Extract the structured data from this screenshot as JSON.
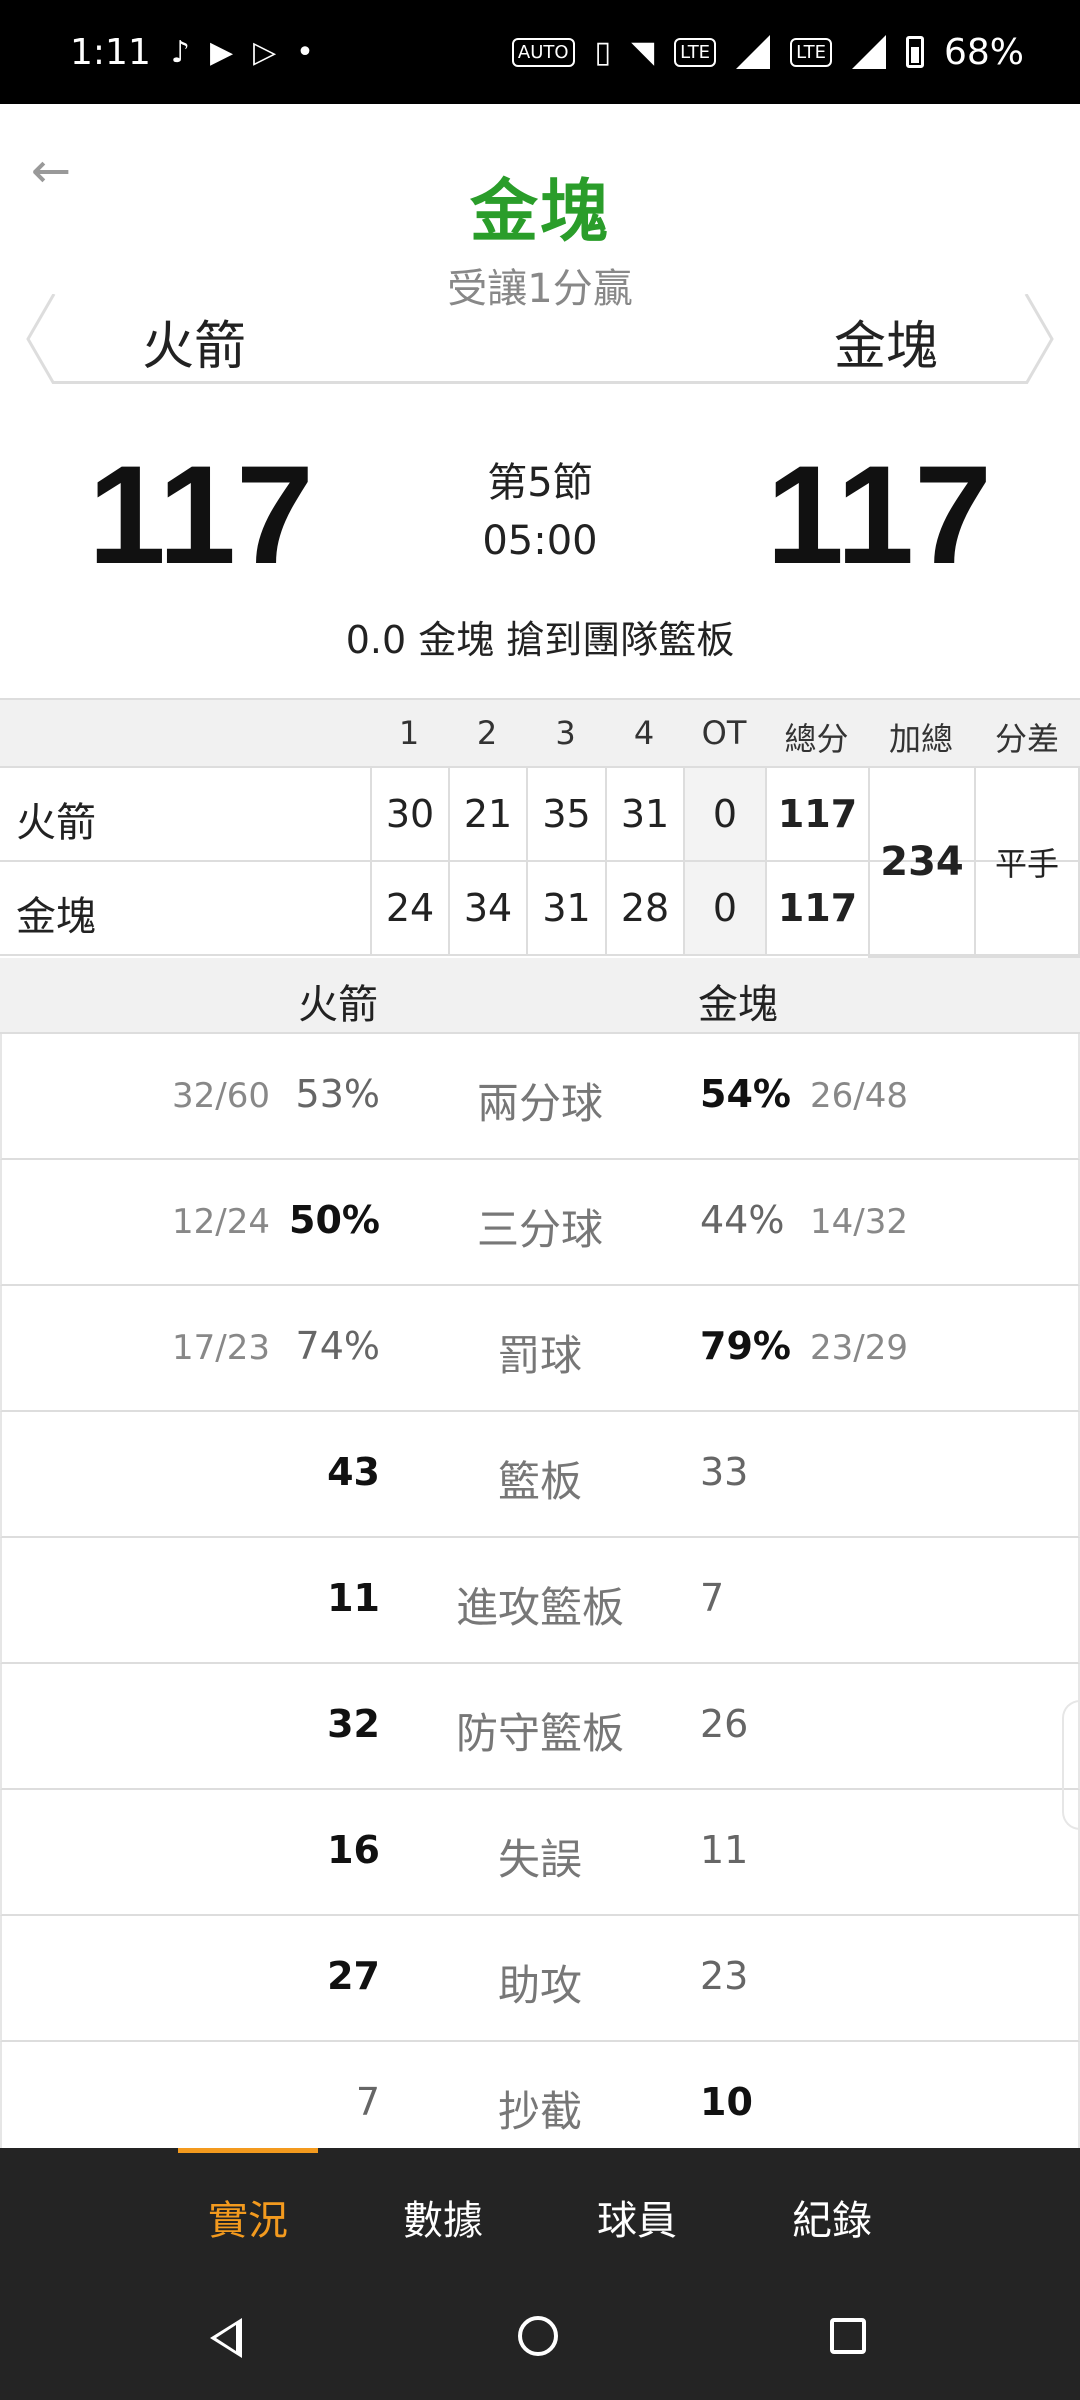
{
  "statusbar": {
    "time": "1:11",
    "battery": "68%"
  },
  "header": {
    "title": "金塊",
    "subtitle": "受讓1分贏",
    "home_team": "火箭",
    "away_team": "金塊",
    "home_score": "117",
    "away_score": "117",
    "period": "第5節",
    "clock": "05:00",
    "last_play": "0.0 金塊  搶到團隊籃板"
  },
  "boxscore": {
    "columns": [
      "1",
      "2",
      "3",
      "4",
      "OT",
      "總分",
      "加總",
      "分差"
    ],
    "rows": [
      {
        "team": "火箭",
        "q": [
          "30",
          "21",
          "35",
          "31",
          "0"
        ],
        "total": "117"
      },
      {
        "team": "金塊",
        "q": [
          "24",
          "34",
          "31",
          "28",
          "0"
        ],
        "total": "117"
      }
    ],
    "sum": "234",
    "diff": "平手"
  },
  "stats": {
    "home_label": "火箭",
    "away_label": "金塊",
    "rows": [
      {
        "label": "兩分球",
        "home_frac": "32/60",
        "home": "53%",
        "away": "54%",
        "away_frac": "26/48"
      },
      {
        "label": "三分球",
        "home_frac": "12/24",
        "home": "50%",
        "away": "44%",
        "away_frac": "14/32"
      },
      {
        "label": "罰球",
        "home_frac": "17/23",
        "home": "74%",
        "away": "79%",
        "away_frac": "23/29"
      },
      {
        "label": "籃板",
        "home_frac": "",
        "home": "43",
        "away": "33",
        "away_frac": ""
      },
      {
        "label": "進攻籃板",
        "home_frac": "",
        "home": "11",
        "away": "7",
        "away_frac": ""
      },
      {
        "label": "防守籃板",
        "home_frac": "",
        "home": "32",
        "away": "26",
        "away_frac": ""
      },
      {
        "label": "失誤",
        "home_frac": "",
        "home": "16",
        "away": "11",
        "away_frac": ""
      },
      {
        "label": "助攻",
        "home_frac": "",
        "home": "27",
        "away": "23",
        "away_frac": ""
      },
      {
        "label": "抄截",
        "home_frac": "",
        "home": "7",
        "away": "10",
        "away_frac": ""
      }
    ]
  },
  "nav": {
    "items": [
      "實況",
      "數據",
      "球員",
      "紀錄"
    ],
    "active": 0
  },
  "colors": {
    "accent": "#f39a1e",
    "title_green": "#2a9d2a"
  }
}
